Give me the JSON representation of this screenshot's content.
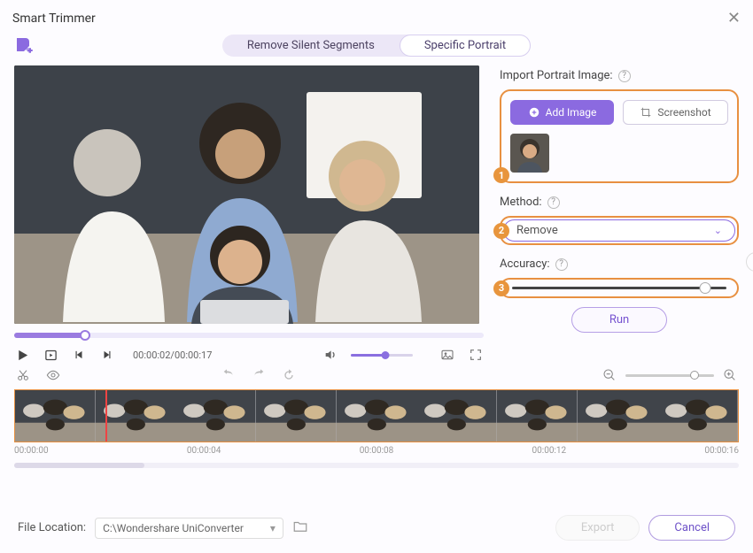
{
  "window": {
    "title": "Smart Trimmer"
  },
  "tabs": {
    "remove_silent": "Remove Silent Segments",
    "specific_portrait": "Specific Portrait"
  },
  "side": {
    "import_label": "Import Portrait Image:",
    "add_image": "Add Image",
    "screenshot": "Screenshot",
    "method_label": "Method:",
    "method_value": "Remove",
    "accuracy_label": "Accuracy:",
    "accuracy_value": "9",
    "run": "Run",
    "badge1": "1",
    "badge2": "2",
    "badge3": "3"
  },
  "playback": {
    "current": "00:00:02",
    "duration": "00:00:17"
  },
  "timeline": {
    "marks": [
      "00:00:00",
      "00:00:04",
      "00:00:08",
      "00:00:12",
      "00:00:16"
    ]
  },
  "footer": {
    "label": "File Location:",
    "path": "C:\\Wondershare UniConverter",
    "export": "Export",
    "cancel": "Cancel"
  }
}
